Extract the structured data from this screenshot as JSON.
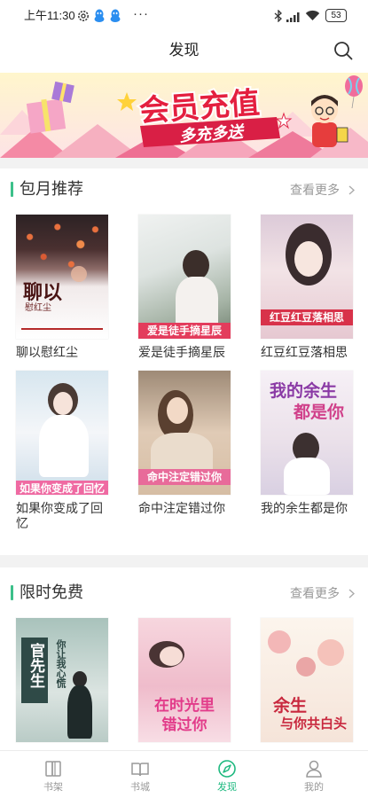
{
  "status_bar": {
    "time": "上午11:30",
    "more_dots": "···",
    "battery_level": "53",
    "icons": [
      "settings-icon",
      "qq-icon",
      "qq-icon",
      "bluetooth-icon",
      "signal-icon",
      "wifi-icon",
      "battery-icon"
    ]
  },
  "header": {
    "title": "发现",
    "search_icon": "search-icon"
  },
  "banner": {
    "headline": "会员充值",
    "tagline": "多充多送"
  },
  "sections": [
    {
      "title": "包月推荐",
      "more_label": "查看更多",
      "more_icon": "chevron-right-icon",
      "books": [
        {
          "title": "聊以慰红尘",
          "cover_lines": [
            "聊以",
            "慰红尘"
          ]
        },
        {
          "title": "爱是徒手摘星辰",
          "cover_lines": [
            "爱是徒手摘星辰"
          ]
        },
        {
          "title": "红豆红豆落相思",
          "cover_lines": [
            "红豆红豆落相思"
          ]
        },
        {
          "title": "如果你变成了回忆",
          "cover_lines": [
            "如果你变成了回忆"
          ]
        },
        {
          "title": "命中注定错过你",
          "cover_lines": [
            "命中注定错过你"
          ]
        },
        {
          "title": "我的余生都是你",
          "cover_lines": [
            "我的余生",
            "都是你"
          ]
        }
      ]
    },
    {
      "title": "限时免费",
      "more_label": "查看更多",
      "more_icon": "chevron-right-icon",
      "books": [
        {
          "cover_lines": [
            "官先生",
            "你让我心慌"
          ]
        },
        {
          "cover_lines": [
            "在时光里",
            "错过你"
          ]
        },
        {
          "cover_lines": [
            "余生",
            "与你共白头"
          ]
        }
      ]
    }
  ],
  "bottom_nav": [
    {
      "label": "书架",
      "icon": "bookshelf-icon",
      "active": false
    },
    {
      "label": "书城",
      "icon": "bookstore-icon",
      "active": false
    },
    {
      "label": "发现",
      "icon": "discover-icon",
      "active": true
    },
    {
      "label": "我的",
      "icon": "profile-icon",
      "active": false
    }
  ],
  "colors": {
    "accent": "#1fb980",
    "section_bar": "#3cc08a",
    "text": "#333333",
    "muted": "#999999",
    "divider": "#f2f2f2"
  }
}
